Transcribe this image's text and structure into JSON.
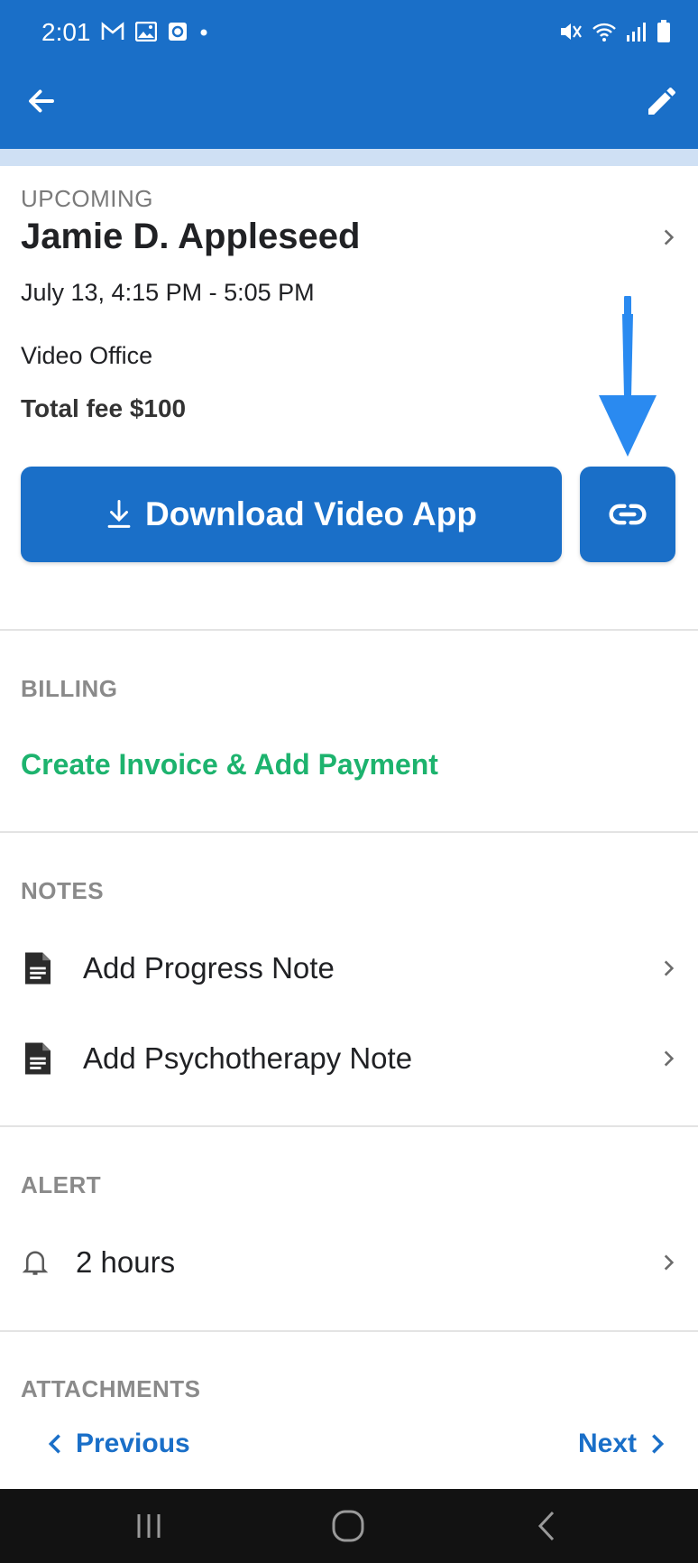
{
  "status_bar": {
    "time": "2:01"
  },
  "appointment": {
    "status": "UPCOMING",
    "client_name": "Jamie D. Appleseed",
    "datetime": "July 13, 4:15 PM - 5:05 PM",
    "location": "Video Office",
    "fee": "Total fee $100",
    "download_label": "Download Video App"
  },
  "billing": {
    "header": "BILLING",
    "action": "Create Invoice & Add Payment"
  },
  "notes": {
    "header": "NOTES",
    "items": [
      {
        "label": "Add Progress Note"
      },
      {
        "label": "Add Psychotherapy Note"
      }
    ]
  },
  "alert": {
    "header": "ALERT",
    "value": "2 hours"
  },
  "attachments": {
    "header": "ATTACHMENTS"
  },
  "nav": {
    "previous": "Previous",
    "next": "Next"
  },
  "colors": {
    "primary": "#1a6fc8",
    "accent_green": "#1db36e",
    "annotation_arrow": "#2a8af0"
  }
}
